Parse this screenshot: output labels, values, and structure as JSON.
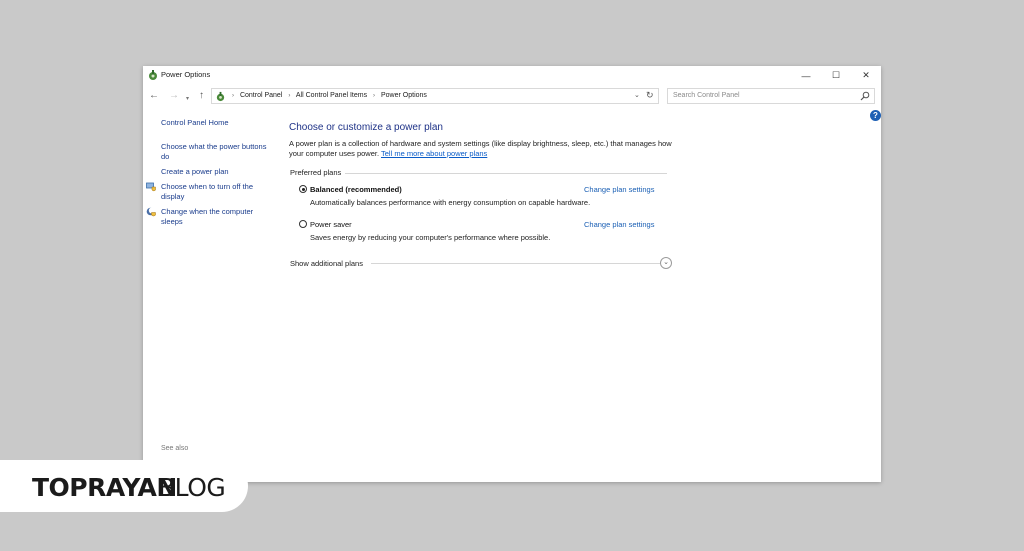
{
  "window": {
    "title": "Power Options",
    "minimize_glyph": "—",
    "maximize_glyph": "☐",
    "close_glyph": "✕"
  },
  "navbar": {
    "back_glyph": "←",
    "forward_glyph": "→",
    "recent_glyph": "▾",
    "up_glyph": "↑",
    "breadcrumbs": [
      "Control Panel",
      "All Control Panel Items",
      "Power Options"
    ],
    "separator": "›",
    "dropdown_glyph": "⌄",
    "refresh_glyph": "↻",
    "search_placeholder": "Search Control Panel"
  },
  "help": {
    "glyph": "?"
  },
  "sidebar": {
    "home": "Control Panel Home",
    "items": [
      {
        "label": "Choose what the power buttons do",
        "icon": "none"
      },
      {
        "label": "Create a power plan",
        "icon": "none"
      },
      {
        "label": "Choose when to turn off the display",
        "icon": "monitor-shield-icon"
      },
      {
        "label": "Change when the computer sleeps",
        "icon": "moon-shield-icon"
      }
    ],
    "see_also": "See also"
  },
  "main": {
    "title": "Choose or customize a power plan",
    "description": "A power plan is a collection of hardware and system settings (like display brightness, sleep, etc.) that manages how your computer uses power. ",
    "description_link": "Tell me more about power plans",
    "group_header": "Preferred plans",
    "plans": [
      {
        "name": "Balanced (recommended)",
        "desc": "Automatically balances performance with energy consumption on capable hardware.",
        "link": "Change plan settings",
        "selected": true
      },
      {
        "name": "Power saver",
        "desc": "Saves energy by reducing your computer's performance where possible.",
        "link": "Change plan settings",
        "selected": false
      }
    ],
    "show_more": "Show additional plans",
    "show_more_glyph": "⌄"
  },
  "watermark": {
    "bold": "TOPRAYAN",
    "light": "BLOG"
  }
}
